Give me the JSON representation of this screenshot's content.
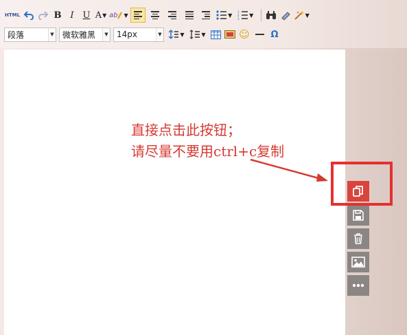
{
  "toolbar": {
    "html_label": "HTML",
    "bold_label": "B",
    "italic_label": "I",
    "underline_label": "U",
    "font_color_label": "A",
    "highlight_label": "ab",
    "paragraph_value": "段落",
    "font_family_value": "微软雅黑",
    "font_size_value": "14px",
    "omega_label": "Ω",
    "smile_label": "☺"
  },
  "annotation": {
    "line1": "直接点击此按钮；",
    "line2": "请尽量不要用ctrl+c复制"
  },
  "side_buttons": [
    "copy-icon",
    "save-icon",
    "trash-icon",
    "image-icon",
    "more-icon"
  ],
  "colors": {
    "annotation": "#d43a32",
    "highlight_box": "#e6302e",
    "copy_button": "#d9443d",
    "side_button": "#8b8584"
  }
}
